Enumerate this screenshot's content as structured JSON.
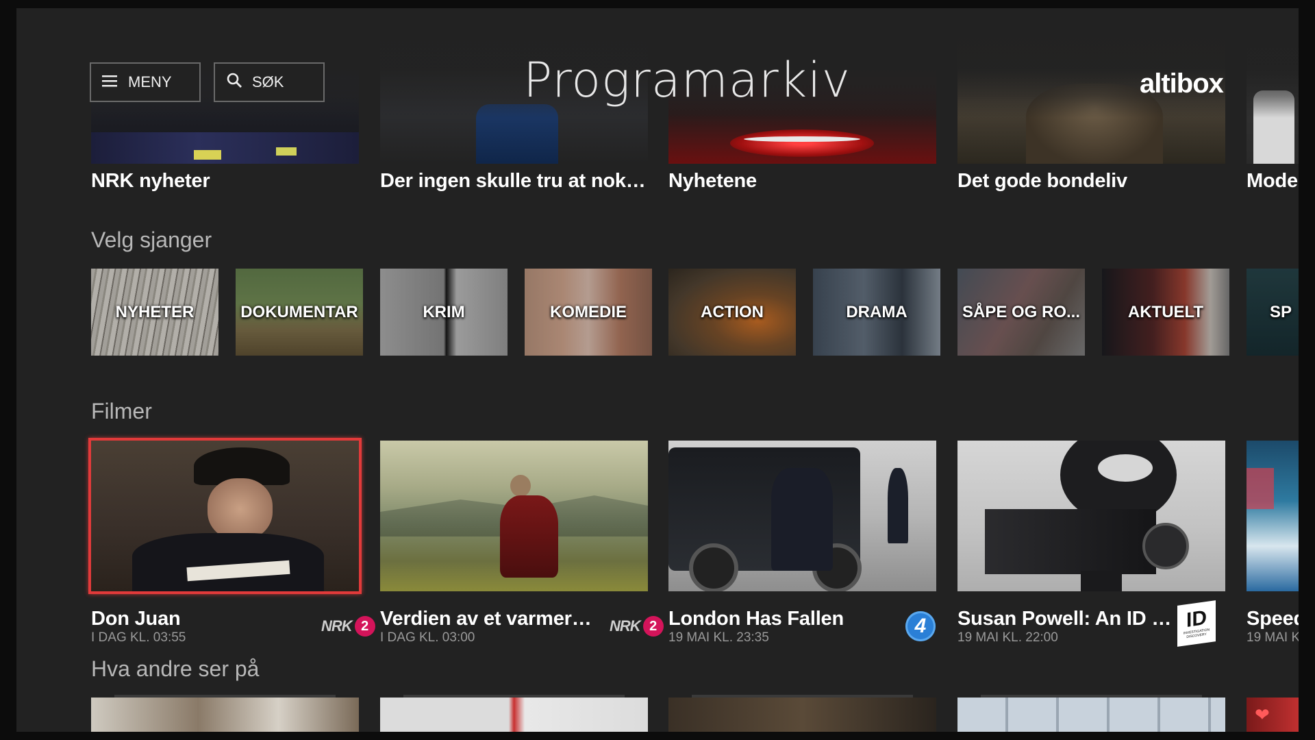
{
  "header": {
    "menu_label": "MENY",
    "search_label": "SØK",
    "title": "Programarkiv",
    "brand": "altibox"
  },
  "top_row": {
    "items": [
      {
        "title": "NRK nyheter"
      },
      {
        "title": "Der ingen skulle tru at nokon ..."
      },
      {
        "title": "Nyhetene"
      },
      {
        "title": "Det gode bondeliv"
      },
      {
        "title": "Moder"
      }
    ]
  },
  "genres": {
    "label": "Velg sjanger",
    "items": [
      {
        "label": "NYHETER"
      },
      {
        "label": "DOKUMENTAR"
      },
      {
        "label": "KRIM"
      },
      {
        "label": "KOMEDIE"
      },
      {
        "label": "ACTION"
      },
      {
        "label": "DRAMA"
      },
      {
        "label": "SÅPE OG RO..."
      },
      {
        "label": "AKTUELT"
      },
      {
        "label": "SP"
      }
    ]
  },
  "films": {
    "label": "Filmer",
    "items": [
      {
        "title": "Don Juan",
        "time": "I DAG KL. 03:55",
        "channel": "nrk2",
        "channel_text": "NRK",
        "channel_num": "2"
      },
      {
        "title": "Verdien av et varmere ...",
        "time": "I DAG KL. 03:00",
        "channel": "nrk2",
        "channel_text": "NRK",
        "channel_num": "2"
      },
      {
        "title": "London Has Fallen",
        "time": "19 MAI KL. 23:35",
        "channel": "tv4",
        "channel_text": "4"
      },
      {
        "title": "Susan Powell: An ID M...",
        "time": "19 MAI KL. 22:00",
        "channel": "id",
        "channel_text": "ID",
        "channel_sub": "INVESTIGATION DISCOVERY"
      },
      {
        "title": "Speed",
        "time": "19 MAI K"
      }
    ]
  },
  "others": {
    "label": "Hva andre ser på"
  },
  "colors": {
    "background": "#222222",
    "focus": "#e23a3a",
    "nrk_badge": "#d4145a",
    "tv4_badge": "#2a7fd6"
  }
}
